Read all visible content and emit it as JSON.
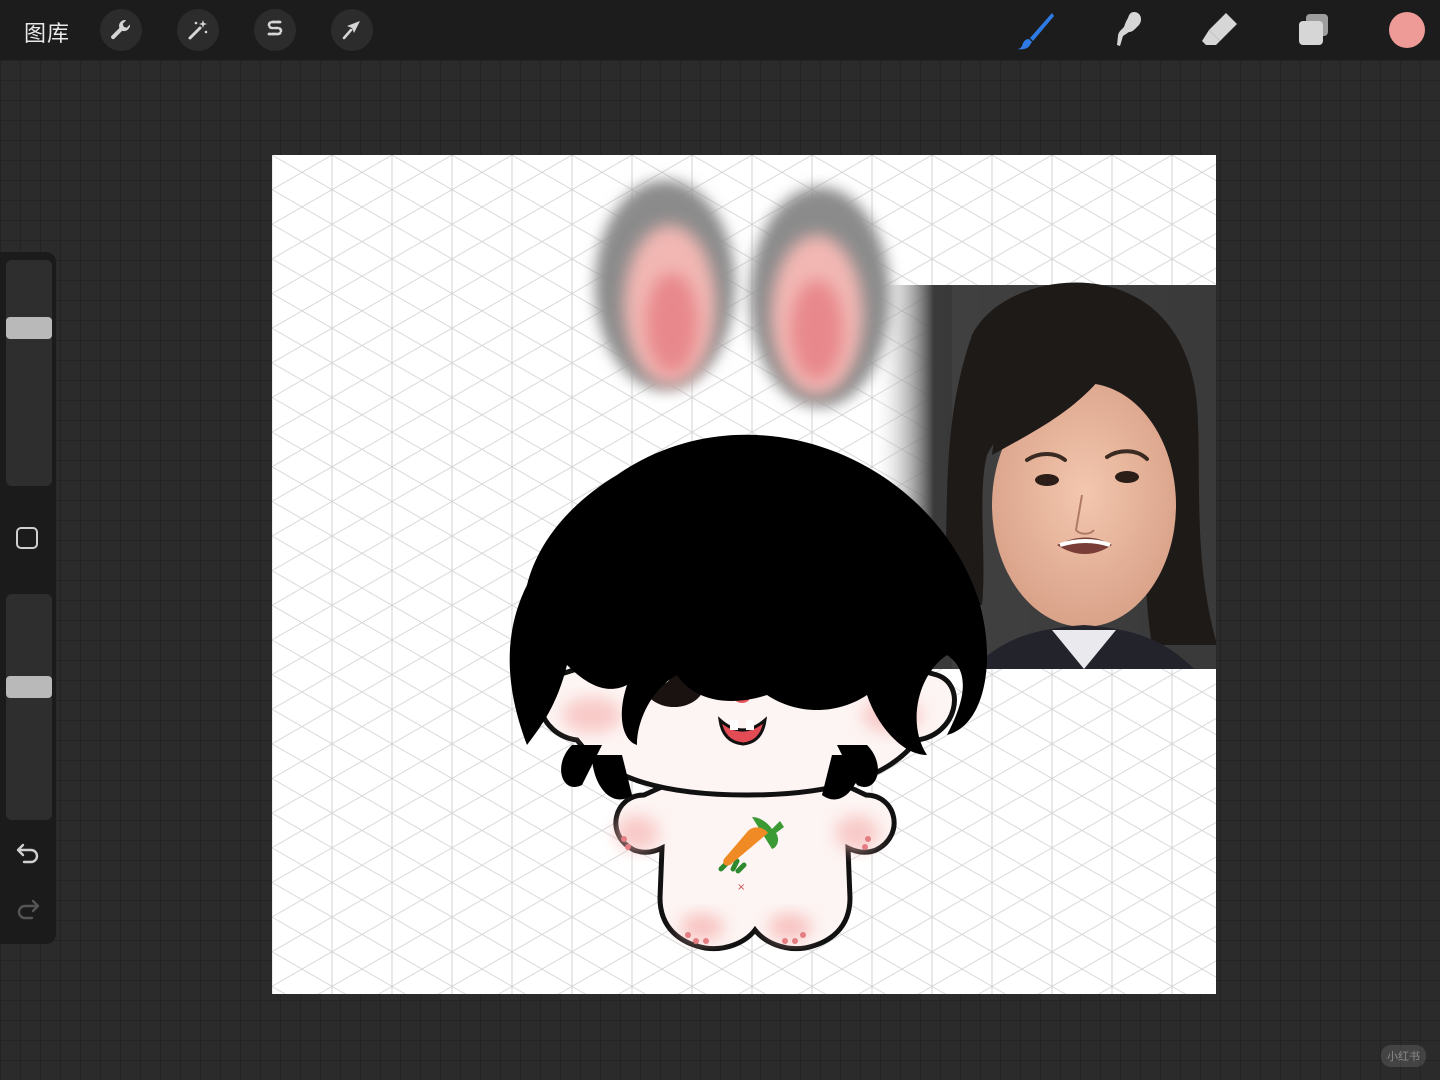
{
  "toolbar": {
    "gallery_label": "图库",
    "left_tools": [
      {
        "name": "actions",
        "icon": "wrench-icon"
      },
      {
        "name": "adjustments",
        "icon": "magic-wand-icon"
      },
      {
        "name": "selection",
        "icon": "selection-s-icon"
      },
      {
        "name": "transform",
        "icon": "arrow-cursor-icon"
      }
    ],
    "right_tools": [
      {
        "name": "brush",
        "icon": "brush-icon",
        "active": true
      },
      {
        "name": "smudge",
        "icon": "smudge-finger-icon",
        "active": false
      },
      {
        "name": "eraser",
        "icon": "eraser-icon",
        "active": false
      },
      {
        "name": "layers",
        "icon": "layers-icon",
        "active": false
      }
    ],
    "active_color": "#ee9b98",
    "accent_color": "#2f7be6"
  },
  "sidebar": {
    "brush_size_level": 0.72,
    "opacity_level": 0.6,
    "modify_button_icon": "square-icon",
    "undo_icon": "undo-icon",
    "redo_icon": "redo-icon"
  },
  "canvas": {
    "background": "#ffffff",
    "grid": "isometric",
    "contents": [
      "bunny-ears-drawing",
      "chibi-doll-drawing",
      "reference-photo"
    ]
  },
  "watermark": {
    "text": "小红书"
  }
}
